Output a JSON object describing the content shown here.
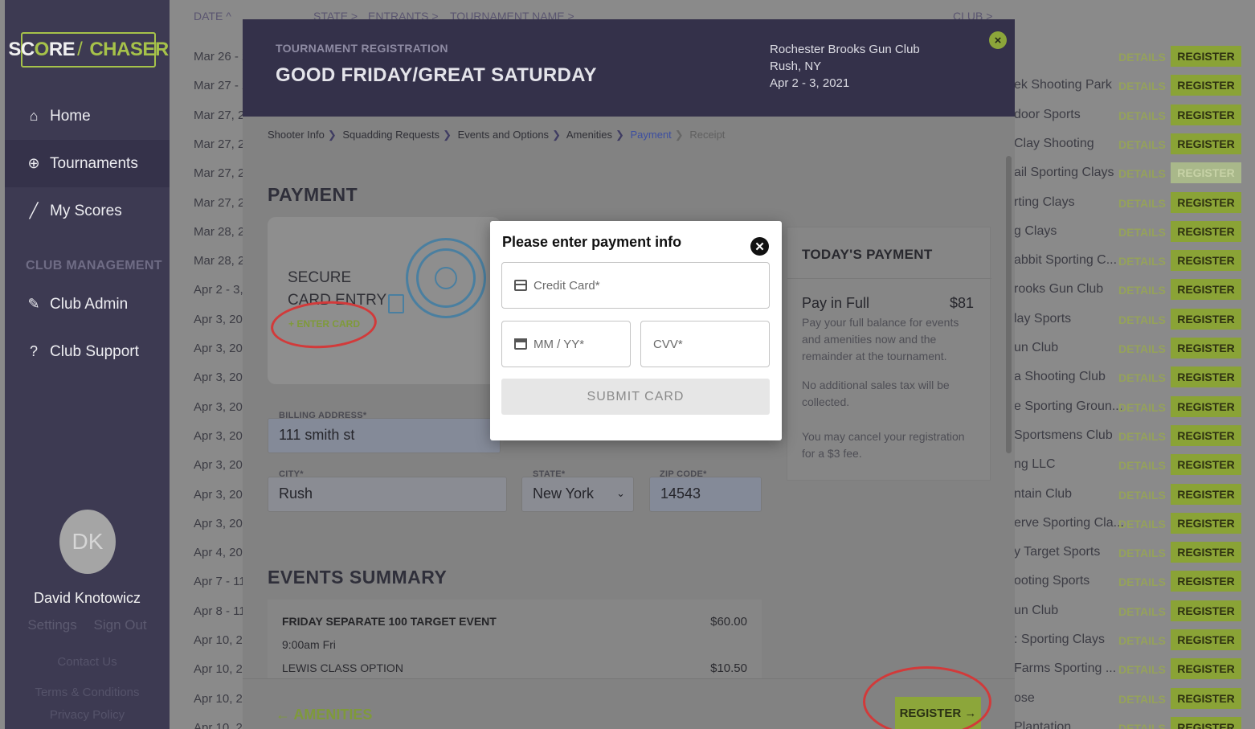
{
  "app": {
    "logo_left": "SC",
    "logo_o": "O",
    "logo_right": "RE",
    "logo_chaser": "CHASER"
  },
  "sidebar": {
    "nav": [
      {
        "label": "Home",
        "icon": "home-icon"
      },
      {
        "label": "Tournaments",
        "icon": "crosshair-icon"
      },
      {
        "label": "My Scores",
        "icon": "pencil-icon"
      }
    ],
    "section_heading": "CLUB MANAGEMENT",
    "club_items": [
      {
        "label": "Club Admin",
        "icon": "wrench-icon"
      },
      {
        "label": "Club Support",
        "icon": "help-icon"
      }
    ],
    "user": {
      "initials": "DK",
      "name": "David Knotowicz",
      "settings": "Settings",
      "sign_out": "Sign Out"
    },
    "footer": {
      "contact": "Contact Us",
      "terms": "Terms & Conditions",
      "privacy": "Privacy Policy"
    }
  },
  "table": {
    "headers": {
      "date": "DATE ^",
      "state": "STATE >",
      "entrants": "ENTRANTS >",
      "name": "TOURNAMENT NAME >",
      "club": "CLUB >"
    },
    "dates": [
      "Mar 26 - 2",
      "Mar 27 - 2",
      "Mar 27, 2",
      "Mar 27, 2",
      "Mar 27, 2",
      "Mar 27, 2",
      "Mar 28, 2",
      "Mar 28, 2",
      "Apr 2 - 3,",
      "Apr 3, 202",
      "Apr 3, 202",
      "Apr 3, 202",
      "Apr 3, 202",
      "Apr 3, 202",
      "Apr 3, 202",
      "Apr 3, 202",
      "Apr 3, 202",
      "Apr 4, 202",
      "Apr 7 - 11",
      "Apr 8 - 11",
      "Apr 10, 20",
      "Apr 10, 20",
      "Apr 10, 20",
      "Apr 10, 20"
    ],
    "clubs": [
      "",
      "ek Shooting Park",
      "door Sports",
      "Clay Shooting",
      "ail Sporting Clays",
      "rting Clays",
      "g Clays",
      "abbit Sporting C...",
      "rooks Gun Club",
      "lay Sports",
      "un Club",
      "a Shooting Club",
      "e Sporting Groun...",
      "Sportsmens Club",
      "ng LLC",
      "ntain Club",
      "erve Sporting Cla...",
      "y Target Sports",
      "ooting Sports",
      "un Club",
      ": Sporting Clays",
      "Farms Sporting ...",
      "ose",
      "Plantation"
    ],
    "details_label": "DETAILS",
    "register_label": "REGISTER"
  },
  "registration": {
    "subtitle": "TOURNAMENT REGISTRATION",
    "title": "GOOD FRIDAY/GREAT SATURDAY",
    "venue_name": "Rochester Brooks Gun Club",
    "venue_city": "Rush, NY",
    "venue_dates": "Apr 2 - 3, 2021",
    "breadcrumbs": [
      "Shooter Info",
      "Squadding Requests",
      "Events and Options",
      "Amenities",
      "Payment",
      "Receipt"
    ],
    "payment_heading": "PAYMENT",
    "secure_card_label": "SECURE CARD ENTRY",
    "enter_card_link": "+ ENTER CARD",
    "billing_label": "BILLING ADDRESS*",
    "billing_value": "111 smith st",
    "city_label": "CITY*",
    "city_value": "Rush",
    "state_label": "STATE*",
    "state_value": "New York",
    "zip_label": "ZIP CODE*",
    "zip_value": "14543",
    "events_heading": "EVENTS SUMMARY",
    "event_name": "FRIDAY SEPARATE 100 TARGET EVENT",
    "event_price": "$60.00",
    "event_time": "9:00am Fri",
    "option_name": "LEWIS CLASS OPTION",
    "option_price": "$10.50",
    "today_heading": "TODAY'S PAYMENT",
    "pay_full_label": "Pay in Full",
    "pay_full_amount": "$81",
    "pay_full_desc": "Pay your full balance for events and amenities now and the remainder at the tournament.",
    "tax_note": "No additional sales tax will be collected.",
    "cancel_note": "You may cancel your registration for a $3 fee.",
    "back_label": "← AMENITIES",
    "register_label": "REGISTER →"
  },
  "payment_dialog": {
    "title": "Please enter payment info",
    "card_placeholder": "Credit Card*",
    "expiry_placeholder": "MM / YY*",
    "cvv_placeholder": "CVV*",
    "submit_label": "SUBMIT CARD"
  },
  "colors": {
    "sidebar": "#3d3a52",
    "accent_green": "#8ca63a",
    "annotation_red": "#d23a3a",
    "link_blue": "#3d4fa0"
  }
}
